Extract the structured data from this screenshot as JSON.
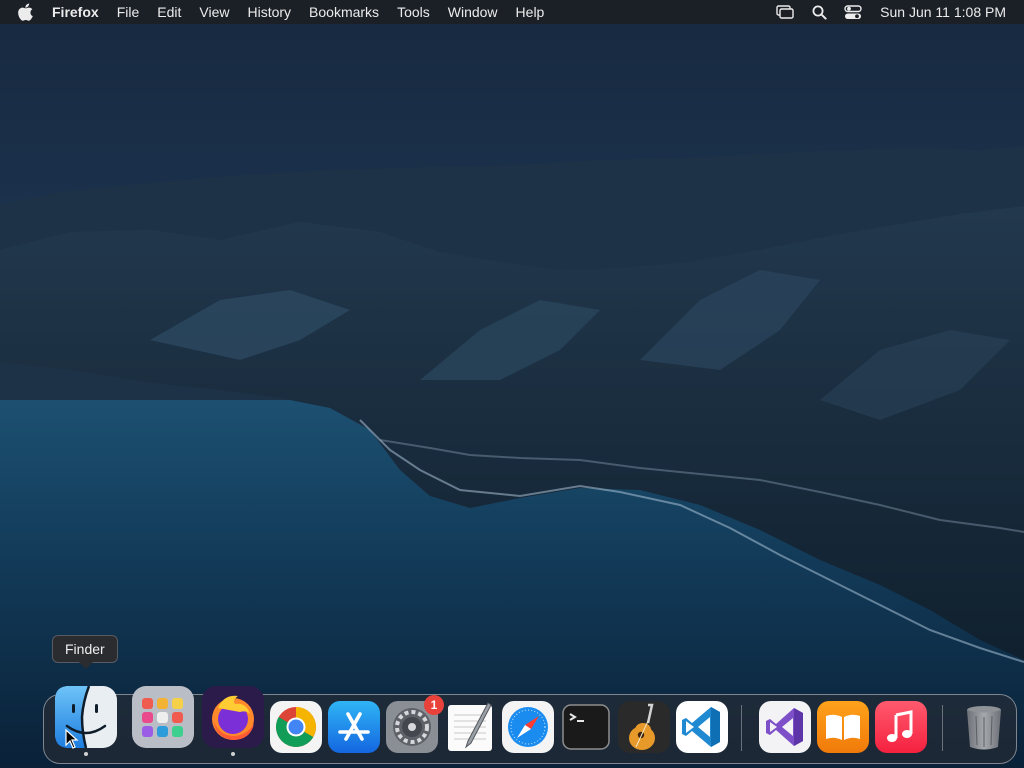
{
  "menubar": {
    "apple_icon": "apple-logo-icon",
    "app_name": "Firefox",
    "items": [
      "File",
      "Edit",
      "View",
      "History",
      "Bookmarks",
      "Tools",
      "Window",
      "Help"
    ],
    "status_icons": [
      "screen-mirroring-icon",
      "search-icon",
      "control-center-icon"
    ],
    "clock": "Sun Jun 11  1:08 PM"
  },
  "tooltip": {
    "text": "Finder"
  },
  "dock": {
    "apps": [
      {
        "name": "Finder",
        "icon": "finder-icon",
        "running": true
      },
      {
        "name": "Launchpad",
        "icon": "launchpad-icon",
        "running": false
      },
      {
        "name": "Firefox",
        "icon": "firefox-icon",
        "running": true
      },
      {
        "name": "Google Chrome",
        "icon": "chrome-icon",
        "running": false
      },
      {
        "name": "App Store",
        "icon": "app-store-icon",
        "running": false
      },
      {
        "name": "System Preferences",
        "icon": "system-preferences-icon",
        "running": false,
        "badge": "1"
      },
      {
        "name": "TextEdit",
        "icon": "textedit-icon",
        "running": false
      },
      {
        "name": "Safari",
        "icon": "safari-icon",
        "running": false
      },
      {
        "name": "Terminal",
        "icon": "terminal-icon",
        "running": false
      },
      {
        "name": "GarageBand",
        "icon": "garageband-icon",
        "running": false
      },
      {
        "name": "Visual Studio Code",
        "icon": "vscode-icon",
        "running": false
      },
      {
        "name": "Visual Studio",
        "icon": "visual-studio-icon",
        "running": false
      },
      {
        "name": "Books",
        "icon": "books-icon",
        "running": false
      },
      {
        "name": "Music",
        "icon": "music-icon",
        "running": false
      },
      {
        "name": "Trash",
        "icon": "trash-icon",
        "running": false
      }
    ]
  },
  "colors": {
    "menubar_bg": "#1c1e24",
    "badge": "#e8423b",
    "sky": "#1f3a5c",
    "sea": "#0e3552"
  }
}
